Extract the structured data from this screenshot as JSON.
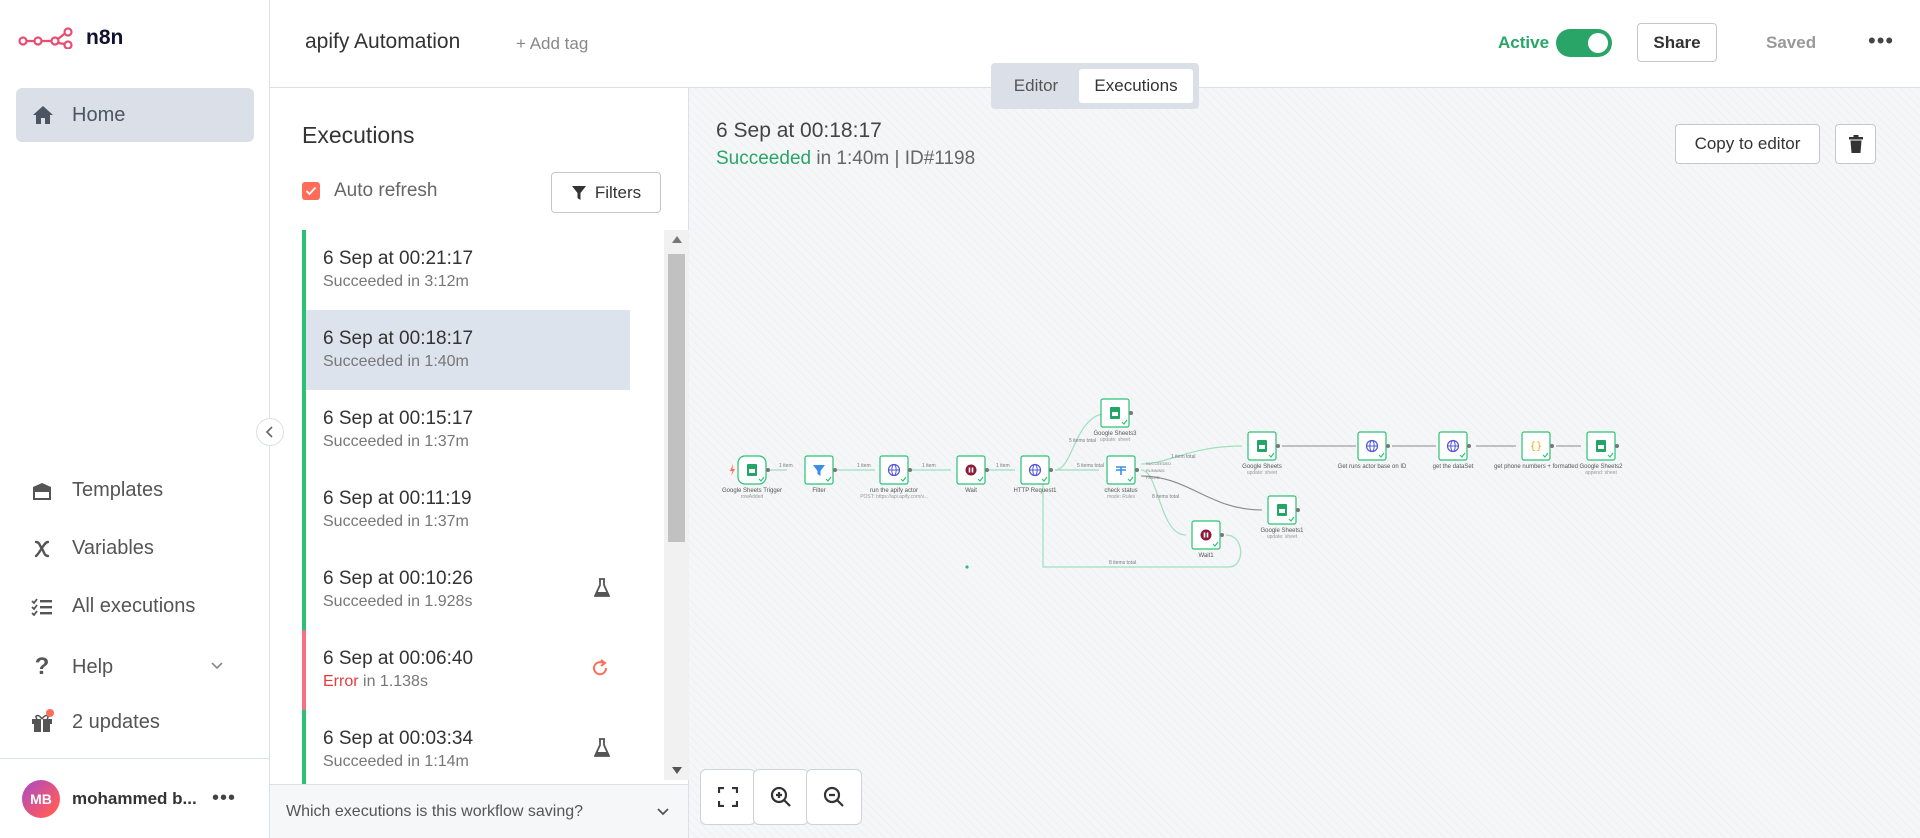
{
  "sidebar": {
    "logo_text": "n8n",
    "home": "Home",
    "items": [
      {
        "label": "Templates",
        "icon": "box-icon"
      },
      {
        "label": "Variables",
        "icon": "variable-icon"
      },
      {
        "label": "All executions",
        "icon": "tasks-icon"
      },
      {
        "label": "Help",
        "icon": "question-icon"
      },
      {
        "label": "2 updates",
        "icon": "gift-icon"
      }
    ],
    "user_initials": "MB",
    "user_name": "mohammed b..."
  },
  "header": {
    "workflow_name": "apify Automation",
    "add_tag": "+ Add tag",
    "active_label": "Active",
    "share": "Share",
    "saved": "Saved",
    "tabs": [
      "Editor",
      "Executions"
    ],
    "active_tab": "Executions"
  },
  "executions": {
    "title": "Executions",
    "auto_refresh": "Auto refresh",
    "filters": "Filters",
    "items": [
      {
        "date": "6 Sep at 00:21:17",
        "status": "Succeeded",
        "detail": "in 3:12m",
        "state": "success",
        "badge": ""
      },
      {
        "date": "6 Sep at 00:18:17",
        "status": "Succeeded",
        "detail": "in 1:40m",
        "state": "success",
        "badge": "",
        "selected": true
      },
      {
        "date": "6 Sep at 00:15:17",
        "status": "Succeeded",
        "detail": "in 1:37m",
        "state": "success",
        "badge": ""
      },
      {
        "date": "6 Sep at 00:11:19",
        "status": "Succeeded",
        "detail": "in 1:37m",
        "state": "success",
        "badge": ""
      },
      {
        "date": "6 Sep at 00:10:26",
        "status": "Succeeded",
        "detail": "in 1.928s",
        "state": "success",
        "badge": "flask-icon"
      },
      {
        "date": "6 Sep at 00:06:40",
        "status": "Error",
        "detail": "in 1.138s",
        "state": "error",
        "badge": "retry-icon"
      },
      {
        "date": "6 Sep at 00:03:34",
        "status": "Succeeded",
        "detail": "in 1:14m",
        "state": "success",
        "badge": "flask-icon"
      }
    ],
    "footer_question": "Which executions is this workflow saving?"
  },
  "canvas": {
    "run_date": "6 Sep at 00:18:17",
    "run_status": "Succeeded",
    "run_detail": "in 1:40m | ID#1198",
    "copy_to_editor": "Copy to editor",
    "nodes": [
      {
        "id": "trigger",
        "label": "Google Sheets Trigger",
        "sub": "rowAdded",
        "icon": "sheets-icon"
      },
      {
        "id": "filter",
        "label": "Filter",
        "sub": "",
        "icon": "filter-icon"
      },
      {
        "id": "apify",
        "label": "run the apify actor",
        "sub": "POST: https://api.apify.com/v...",
        "icon": "globe-icon"
      },
      {
        "id": "wait",
        "label": "Wait",
        "sub": "",
        "icon": "pause-icon"
      },
      {
        "id": "http1",
        "label": "HTTP Request1",
        "sub": "",
        "icon": "globe-icon"
      },
      {
        "id": "gs3",
        "label": "Google Sheets3",
        "sub": "update: sheet",
        "icon": "sheets-icon"
      },
      {
        "id": "check",
        "label": "check status",
        "sub": "mode: Rules",
        "icon": "switch-icon"
      },
      {
        "id": "gs",
        "label": "Google Sheets",
        "sub": "update: sheet",
        "icon": "sheets-icon"
      },
      {
        "id": "gs1",
        "label": "Google Sheets1",
        "sub": "update: sheet",
        "icon": "sheets-icon"
      },
      {
        "id": "wait1",
        "label": "Wait1",
        "sub": "",
        "icon": "pause-icon"
      },
      {
        "id": "runs",
        "label": "Get runs actor base on ID",
        "sub": "",
        "icon": "globe-icon"
      },
      {
        "id": "dataset",
        "label": "get the dataSet",
        "sub": "",
        "icon": "globe-icon"
      },
      {
        "id": "phones",
        "label": "get phone numbers + formatted",
        "sub": "",
        "icon": "code-icon"
      },
      {
        "id": "gs2",
        "label": "Google Sheets2",
        "sub": "append: sheet",
        "icon": "sheets-icon"
      }
    ],
    "edge_labels": [
      "1 item",
      "1 item",
      "1 item",
      "1 item",
      "5 items total",
      "5 items total",
      "1 item total",
      "8 items total",
      "8 items total"
    ],
    "switch_outputs": [
      "SUCCEEDED",
      "RUNNING",
      "FAILED"
    ]
  },
  "colors": {
    "accent": "#ff6d5a",
    "success": "#29a568",
    "error": "#ea3a3a",
    "selected_row": "#dde3ed"
  }
}
